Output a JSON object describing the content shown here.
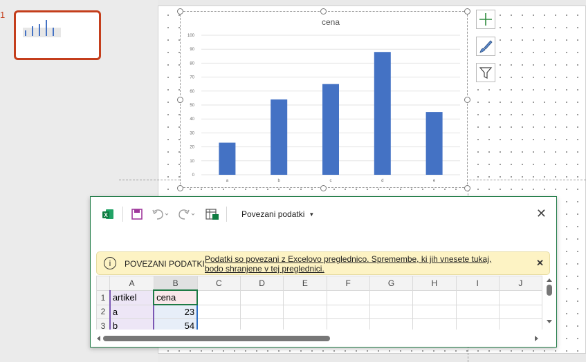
{
  "thumbnail_pane": {
    "slide_number": "1"
  },
  "chart_data": {
    "type": "bar",
    "title": "cena",
    "categories": [
      "a",
      "b",
      "c",
      "d",
      "e"
    ],
    "values": [
      23,
      54,
      65,
      88,
      45
    ],
    "ylim": [
      0,
      100
    ],
    "yticks": [
      "0",
      "10",
      "20",
      "30",
      "40",
      "50",
      "60",
      "70",
      "80",
      "90",
      "100"
    ],
    "grid": true,
    "bar_color": "#4472c4"
  },
  "excel_window": {
    "linked_data_label": "Povezani podatki",
    "info_bar": {
      "title": "POVEZANI PODATKI",
      "message": "Podatki so povezani z Excelovo preglednico. Spremembe, ki jih vnesete tukaj, bodo shranjene v tej preglednici."
    },
    "columns": [
      "A",
      "B",
      "C",
      "D",
      "E",
      "F",
      "G",
      "H",
      "I",
      "J"
    ],
    "rows": [
      {
        "num": "1",
        "cells": [
          "artikel",
          "cena"
        ]
      },
      {
        "num": "2",
        "cells": [
          "a",
          "23"
        ]
      },
      {
        "num": "3",
        "cells": [
          "b",
          "54"
        ]
      }
    ]
  },
  "colors": {
    "excel_green": "#1e7a45",
    "accent_red": "#c43e1c",
    "info_yellow": "#fdf3c4"
  }
}
